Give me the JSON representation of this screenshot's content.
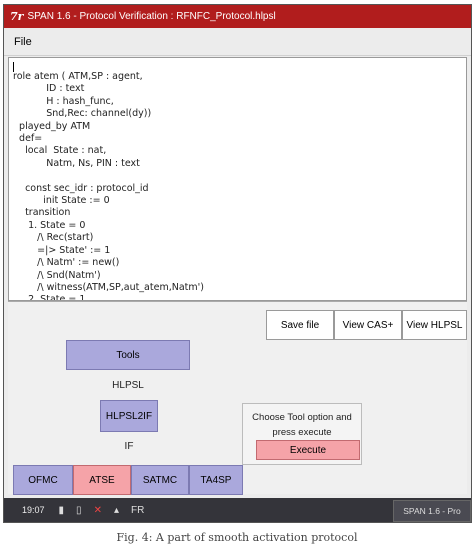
{
  "window": {
    "logo": "7r",
    "title": "SPAN 1.6 - Protocol Verification : RFNFC_Protocol.hlpsl"
  },
  "menu": {
    "file": "File"
  },
  "editor": {
    "text": "role atem ( ATM,SP : agent,\n           ID : text\n           H : hash_func,\n           Snd,Rec: channel(dy))\n  played_by ATM\n  def=\n    local  State : nat,\n           Natm, Ns, PIN : text\n\n    const sec_idr : protocol_id\n          init State := 0\n    transition\n     1. State = 0\n        /\\ Rec(start)\n        =|> State' := 1\n        /\\ Natm' := new()\n        /\\ Snd(Natm')\n        /\\ witness(ATM,SP,aut_atem,Natm')\n     2. State = 1"
  },
  "panel": {
    "save_file": "Save file",
    "view_cas": "View CAS+",
    "view_hlpsl": "View HLPSL",
    "tools": "Tools",
    "hlpsl_label": "HLPSL",
    "hlpsl2if": "HLPSL2IF",
    "if_label": "IF",
    "hint": "Choose Tool option and press execute",
    "execute": "Execute",
    "ofmc": "OFMC",
    "atse": "ATSE",
    "satmc": "SATMC",
    "ta4sp": "TA4SP"
  },
  "taskbar": {
    "clock": "19:07",
    "tray_extra": "FR",
    "task_label": "SPAN 1.6 - Pro"
  },
  "caption": "Fig. 4: A part of smooth activation protocol"
}
